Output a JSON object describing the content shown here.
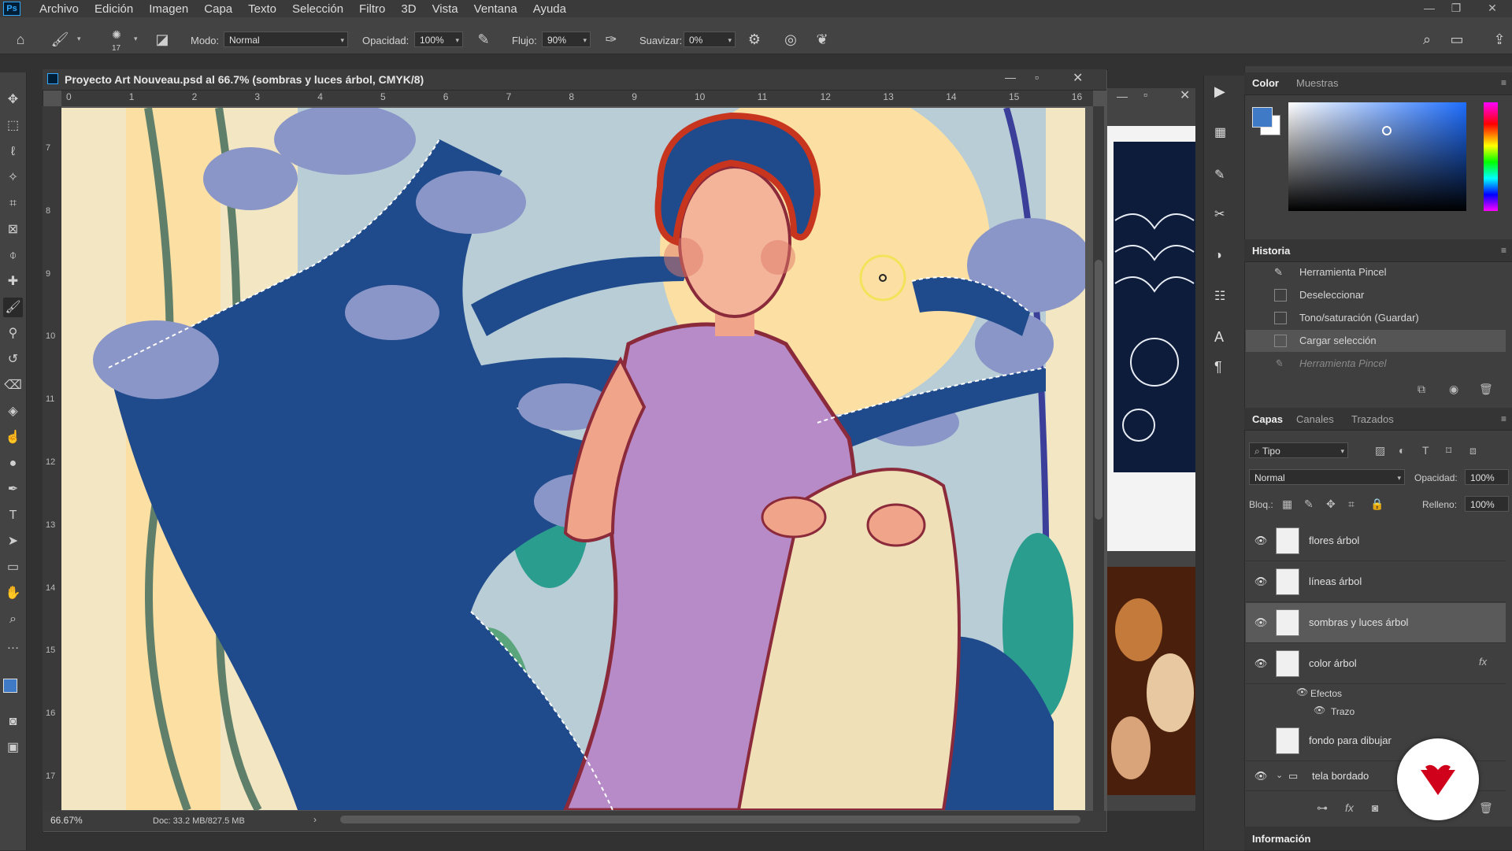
{
  "app": {
    "logo": "Ps"
  },
  "menu": [
    "Archivo",
    "Edición",
    "Imagen",
    "Capa",
    "Texto",
    "Selección",
    "Filtro",
    "3D",
    "Vista",
    "Ventana",
    "Ayuda"
  ],
  "options": {
    "brush_size": "17",
    "mode_label": "Modo:",
    "mode_value": "Normal",
    "opacity_label": "Opacidad:",
    "opacity_value": "100%",
    "flow_label": "Flujo:",
    "flow_value": "90%",
    "smooth_label": "Suavizar:",
    "smooth_value": "0%"
  },
  "document": {
    "title": "Proyecto Art Nouveau.psd al 66.7% (sombras y luces árbol, CMYK/8)",
    "zoom": "66.67%",
    "doc_size": "Doc: 33.2 MB/827.5 MB",
    "ruler_h": [
      "0",
      "1",
      "2",
      "3",
      "4",
      "5",
      "6",
      "7",
      "8",
      "9",
      "10",
      "11",
      "12",
      "13",
      "14",
      "15",
      "16"
    ],
    "ruler_v": [
      "7",
      "8",
      "9",
      "10",
      "11",
      "12",
      "13",
      "14",
      "15",
      "16",
      "17"
    ]
  },
  "panels": {
    "color": {
      "tabs": [
        "Color",
        "Muestras"
      ],
      "foreground": "#3f7ac7",
      "background": "#ffffff"
    },
    "history": {
      "title": "Historia",
      "items": [
        {
          "label": "Herramienta Pincel",
          "icon": "brush-icon",
          "state": "past"
        },
        {
          "label": "Deseleccionar",
          "icon": "document-icon",
          "state": "past"
        },
        {
          "label": "Tono/saturación (Guardar)",
          "icon": "document-icon",
          "state": "past"
        },
        {
          "label": "Cargar selección",
          "icon": "document-icon",
          "state": "current"
        },
        {
          "label": "Herramienta Pincel",
          "icon": "brush-icon",
          "state": "undone"
        }
      ]
    },
    "layers": {
      "tabs": [
        "Capas",
        "Canales",
        "Trazados"
      ],
      "filter": "Tipo",
      "blend_mode": "Normal",
      "opacity_label": "Opacidad:",
      "opacity_value": "100%",
      "lock_label": "Bloq.:",
      "fill_label": "Relleno:",
      "fill_value": "100%",
      "items": [
        {
          "name": "flores árbol",
          "visible": true,
          "selected": false
        },
        {
          "name": "líneas árbol",
          "visible": true,
          "selected": false
        },
        {
          "name": "sombras y luces árbol",
          "visible": true,
          "selected": true
        },
        {
          "name": "color árbol",
          "visible": true,
          "selected": false,
          "fx": "fx"
        }
      ],
      "effects_label": "Efectos",
      "stroke_label": "Trazo",
      "bottom_items": [
        {
          "name": "fondo para dibujar",
          "visible": false
        },
        {
          "name": "tela bordado",
          "visible": true,
          "group": true
        }
      ]
    },
    "info": {
      "title": "Información"
    }
  },
  "colors": {
    "accent": "#31a8ff",
    "brand": "#d0021b"
  }
}
